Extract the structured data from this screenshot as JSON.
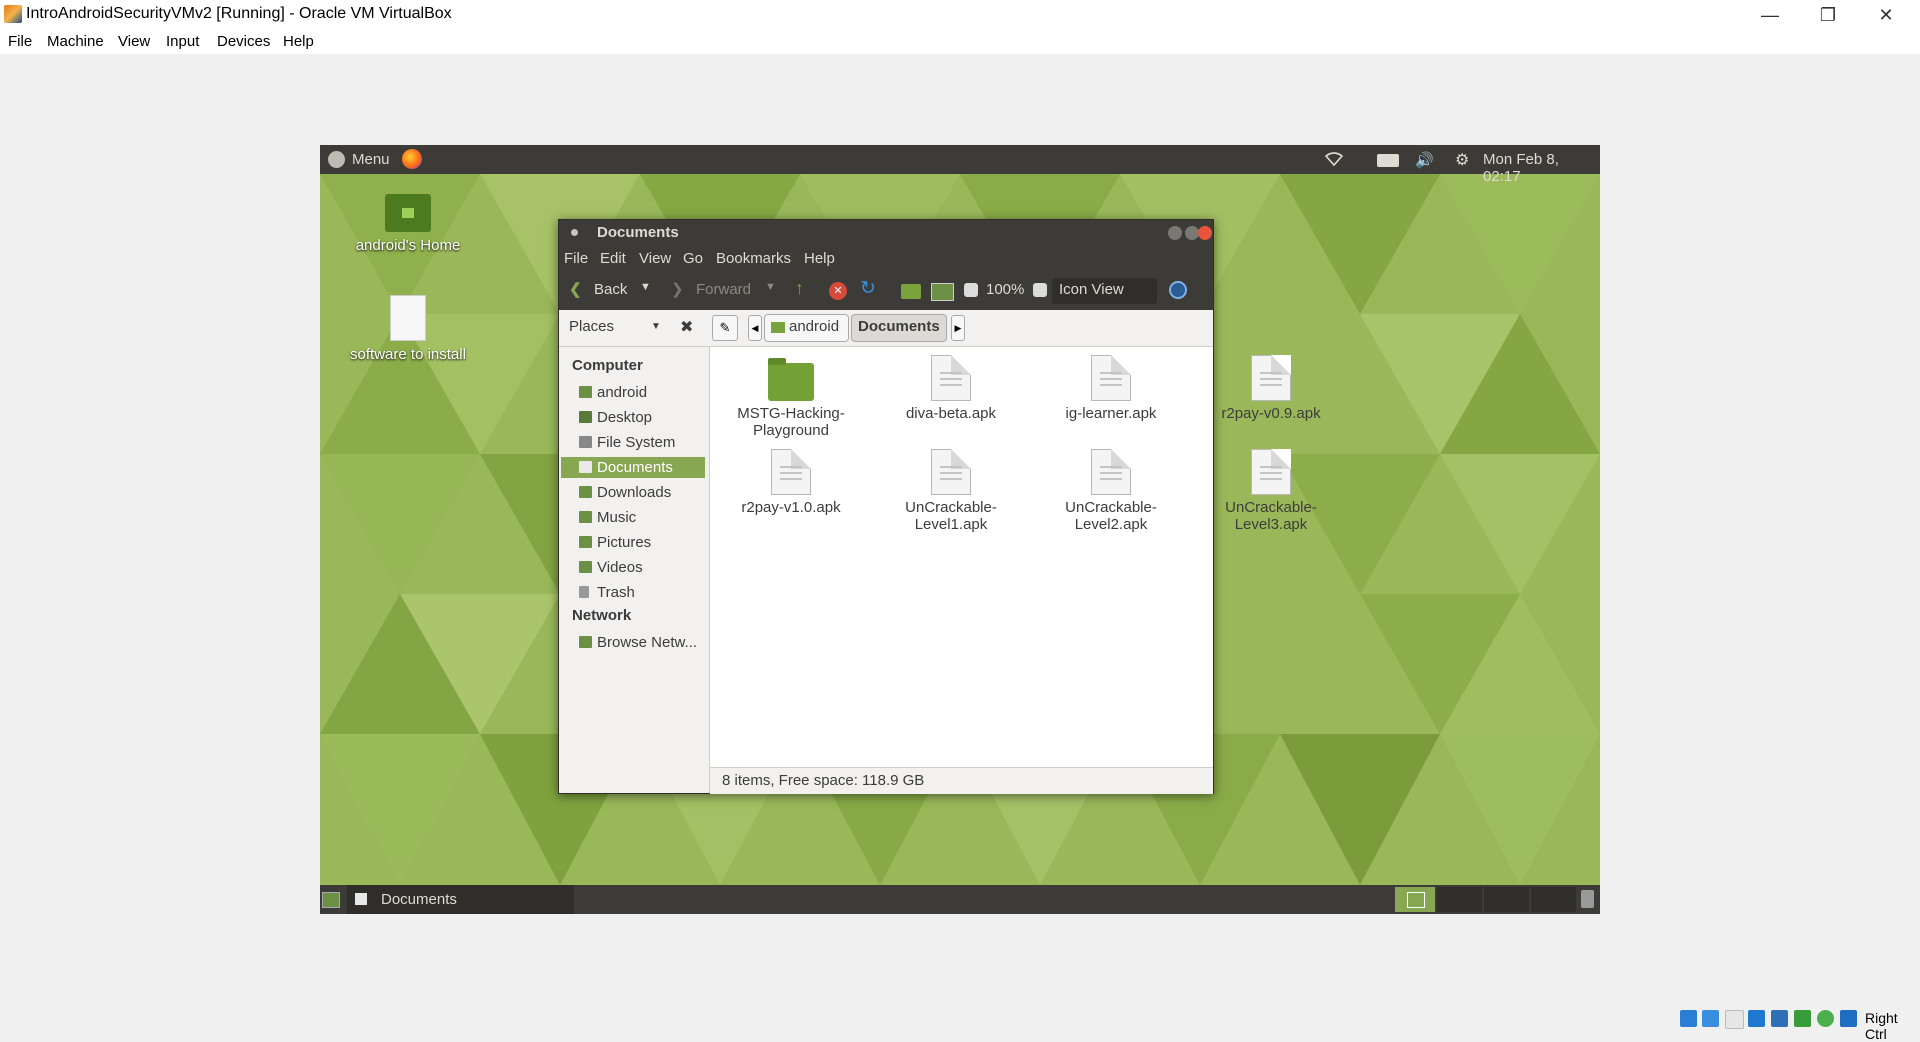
{
  "host": {
    "title": "IntroAndroidSecurityVMv2 [Running] - Oracle VM VirtualBox",
    "menu": [
      "File",
      "Machine",
      "View",
      "Input",
      "Devices",
      "Help"
    ],
    "controls": {
      "minimize": "—",
      "restore": "❐",
      "close": "✕"
    },
    "status_right": "Right Ctrl"
  },
  "guest": {
    "top_panel": {
      "menu_label": "Menu",
      "clock": "Mon Feb  8, 02:17"
    },
    "desktop_icons": [
      {
        "label": "android's Home"
      },
      {
        "label": "software to install"
      }
    ],
    "bottom_panel": {
      "task_label": "Documents"
    }
  },
  "file_manager": {
    "title": "Documents",
    "menu": [
      "File",
      "Edit",
      "View",
      "Go",
      "Bookmarks",
      "Help"
    ],
    "toolbar": {
      "back": "Back",
      "forward": "Forward",
      "zoom": "100%",
      "view_mode": "Icon View"
    },
    "places_label": "Places",
    "path": [
      "android",
      "Documents"
    ],
    "sidebar": {
      "computer_heading": "Computer",
      "items": [
        "android",
        "Desktop",
        "File System",
        "Documents",
        "Downloads",
        "Music",
        "Pictures",
        "Videos",
        "Trash"
      ],
      "network_heading": "Network",
      "network_items": [
        "Browse Netw..."
      ]
    },
    "files": [
      {
        "name_line1": "MSTG-Hacking-",
        "name_line2": "Playground",
        "type": "folder"
      },
      {
        "name_line1": "diva-beta.apk",
        "name_line2": "",
        "type": "file"
      },
      {
        "name_line1": "ig-learner.apk",
        "name_line2": "",
        "type": "file"
      },
      {
        "name_line1": "r2pay-v0.9.apk",
        "name_line2": "",
        "type": "file"
      },
      {
        "name_line1": "r2pay-v1.0.apk",
        "name_line2": "",
        "type": "file"
      },
      {
        "name_line1": "UnCrackable-",
        "name_line2": "Level1.apk",
        "type": "file"
      },
      {
        "name_line1": "UnCrackable-",
        "name_line2": "Level2.apk",
        "type": "file"
      },
      {
        "name_line1": "UnCrackable-",
        "name_line2": "Level3.apk",
        "type": "file"
      }
    ],
    "status": "8 items, Free space: 118.9 GB"
  },
  "colors": {
    "panel": "#3c3b37",
    "accent": "#87a752",
    "desktop": "#9ab85a"
  }
}
